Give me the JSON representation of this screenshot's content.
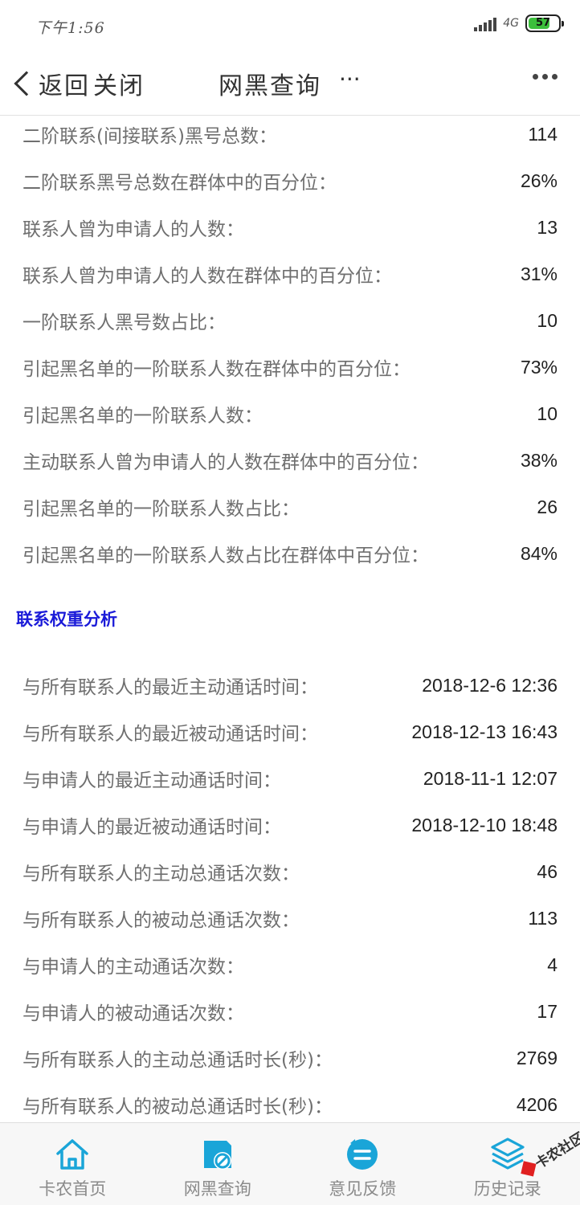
{
  "status_bar": {
    "time": "下午1:56",
    "network": "4G",
    "battery": "57"
  },
  "nav": {
    "back_label": "返回",
    "close_label": "关闭",
    "title": "网黑查询",
    "title_dots": "···"
  },
  "rows_group1": [
    {
      "label": "二阶联系(间接联系)黑号总数：",
      "value": "114"
    },
    {
      "label": "二阶联系黑号总数在群体中的百分位：",
      "value": "26%"
    },
    {
      "label": "联系人曾为申请人的人数：",
      "value": "13"
    },
    {
      "label": "联系人曾为申请人的人数在群体中的百分位：",
      "value": "31%"
    },
    {
      "label": "一阶联系人黑号数占比：",
      "value": "10"
    },
    {
      "label": "引起黑名单的一阶联系人数在群体中的百分位：",
      "value": "73%"
    },
    {
      "label": "引起黑名单的一阶联系人数：",
      "value": "10"
    },
    {
      "label": "主动联系人曾为申请人的人数在群体中的百分位：",
      "value": "38%"
    },
    {
      "label": "引起黑名单的一阶联系人数占比：",
      "value": "26"
    },
    {
      "label": "引起黑名单的一阶联系人数占比在群体中百分位：",
      "value": "84%"
    }
  ],
  "section_title": "联系权重分析",
  "rows_group2": [
    {
      "label": "与所有联系人的最近主动通话时间：",
      "value": "2018-12-6 12:36"
    },
    {
      "label": "与所有联系人的最近被动通话时间：",
      "value": "2018-12-13 16:43"
    },
    {
      "label": "与申请人的最近主动通话时间：",
      "value": "2018-11-1 12:07"
    },
    {
      "label": "与申请人的最近被动通话时间：",
      "value": "2018-12-10 18:48"
    },
    {
      "label": "与所有联系人的主动总通话次数：",
      "value": "46"
    },
    {
      "label": "与所有联系人的被动总通话次数：",
      "value": "113"
    },
    {
      "label": "与申请人的主动通话次数：",
      "value": "4"
    },
    {
      "label": "与申请人的被动通话次数：",
      "value": "17"
    },
    {
      "label": "与所有联系人的主动总通话时长(秒)：",
      "value": "2769"
    },
    {
      "label": "与所有联系人的被动总通话时长(秒)：",
      "value": "4206"
    }
  ],
  "tabs": [
    {
      "label": "卡农首页",
      "icon": "home-icon"
    },
    {
      "label": "网黑查询",
      "icon": "blacklist-query-icon"
    },
    {
      "label": "意见反馈",
      "icon": "feedback-icon"
    },
    {
      "label": "历史记录",
      "icon": "history-icon"
    }
  ],
  "watermark": "卡农社区",
  "colors": {
    "accent": "#1aa5d8",
    "section_title": "#1a1ad8",
    "label": "#6f6f6f"
  }
}
